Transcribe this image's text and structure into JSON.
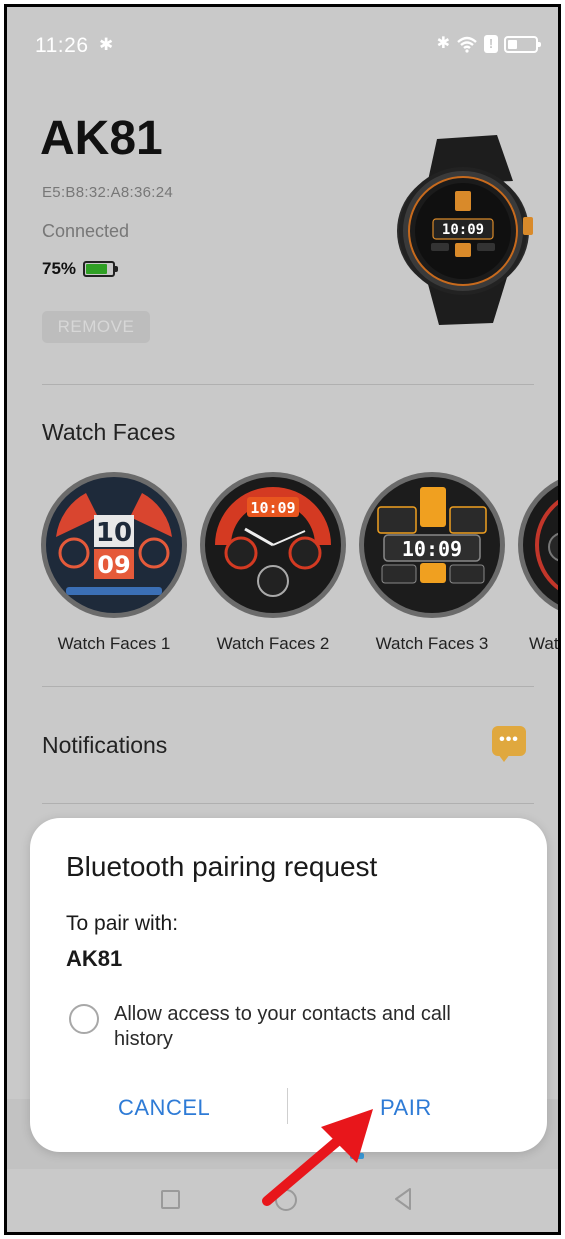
{
  "status_bar": {
    "time": "11:26",
    "bt_glyph": "✱",
    "wifi_glyph": "≋"
  },
  "device": {
    "name": "AK81",
    "mac": "E5:B8:32:A8:36:24",
    "status": "Connected",
    "battery_percent": "75%",
    "battery_level": 0.75,
    "remove_label": "REMOVE"
  },
  "watch_faces": {
    "title": "Watch Faces",
    "items": [
      {
        "label": "Watch Faces 1"
      },
      {
        "label": "Watch Faces 2"
      },
      {
        "label": "Watch Faces 3"
      },
      {
        "label": "Watc"
      }
    ]
  },
  "notifications": {
    "title": "Notifications",
    "icon": "chat-bubble-icon",
    "icon_color": "#e0a83e"
  },
  "dialog": {
    "title": "Bluetooth pairing request",
    "subtitle": "To pair with:",
    "device": "AK81",
    "option_label": "Allow access to your contacts and call history",
    "cancel_label": "CANCEL",
    "pair_label": "PAIR",
    "accent_color": "#2e7bd6"
  },
  "annotation": {
    "arrow_color": "#e8161b"
  }
}
